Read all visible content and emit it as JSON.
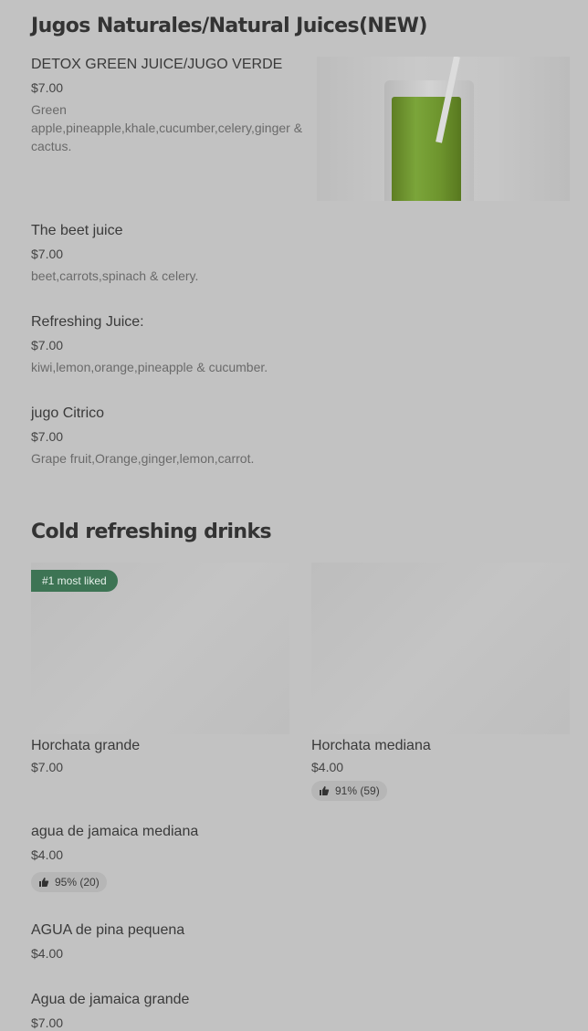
{
  "sections": {
    "juices": {
      "title": "Jugos Naturales/Natural Juices(NEW)"
    },
    "cold": {
      "title": "Cold refreshing drinks"
    }
  },
  "juices": [
    {
      "name": "DETOX GREEN JUICE/JUGO VERDE",
      "price": "$7.00",
      "desc": "Green apple,pineapple,khale,cucumber,celery,ginger & cactus."
    },
    {
      "name": "The beet juice",
      "price": "$7.00",
      "desc": "beet,carrots,spinach & celery."
    },
    {
      "name": "Refreshing Juice:",
      "price": "$7.00",
      "desc": "kiwi,lemon,orange,pineapple & cucumber."
    },
    {
      "name": "jugo Citrico",
      "price": "$7.00",
      "desc": "Grape fruit,Orange,ginger,lemon,carrot."
    }
  ],
  "cards": [
    {
      "name": "Horchata grande",
      "price": "$7.00",
      "badge": "#1 most liked"
    },
    {
      "name": "Horchata mediana",
      "price": "$4.00",
      "rating": "91% (59)"
    }
  ],
  "drinks": [
    {
      "name": "agua de jamaica mediana",
      "price": "$4.00",
      "rating": "95% (20)"
    },
    {
      "name": "AGUA de pina pequena",
      "price": "$4.00"
    },
    {
      "name": "Agua de jamaica grande",
      "price": "$7.00"
    }
  ],
  "icons": {
    "rating": "thumbs-up-icon",
    "badge_color": "#3d7454"
  }
}
